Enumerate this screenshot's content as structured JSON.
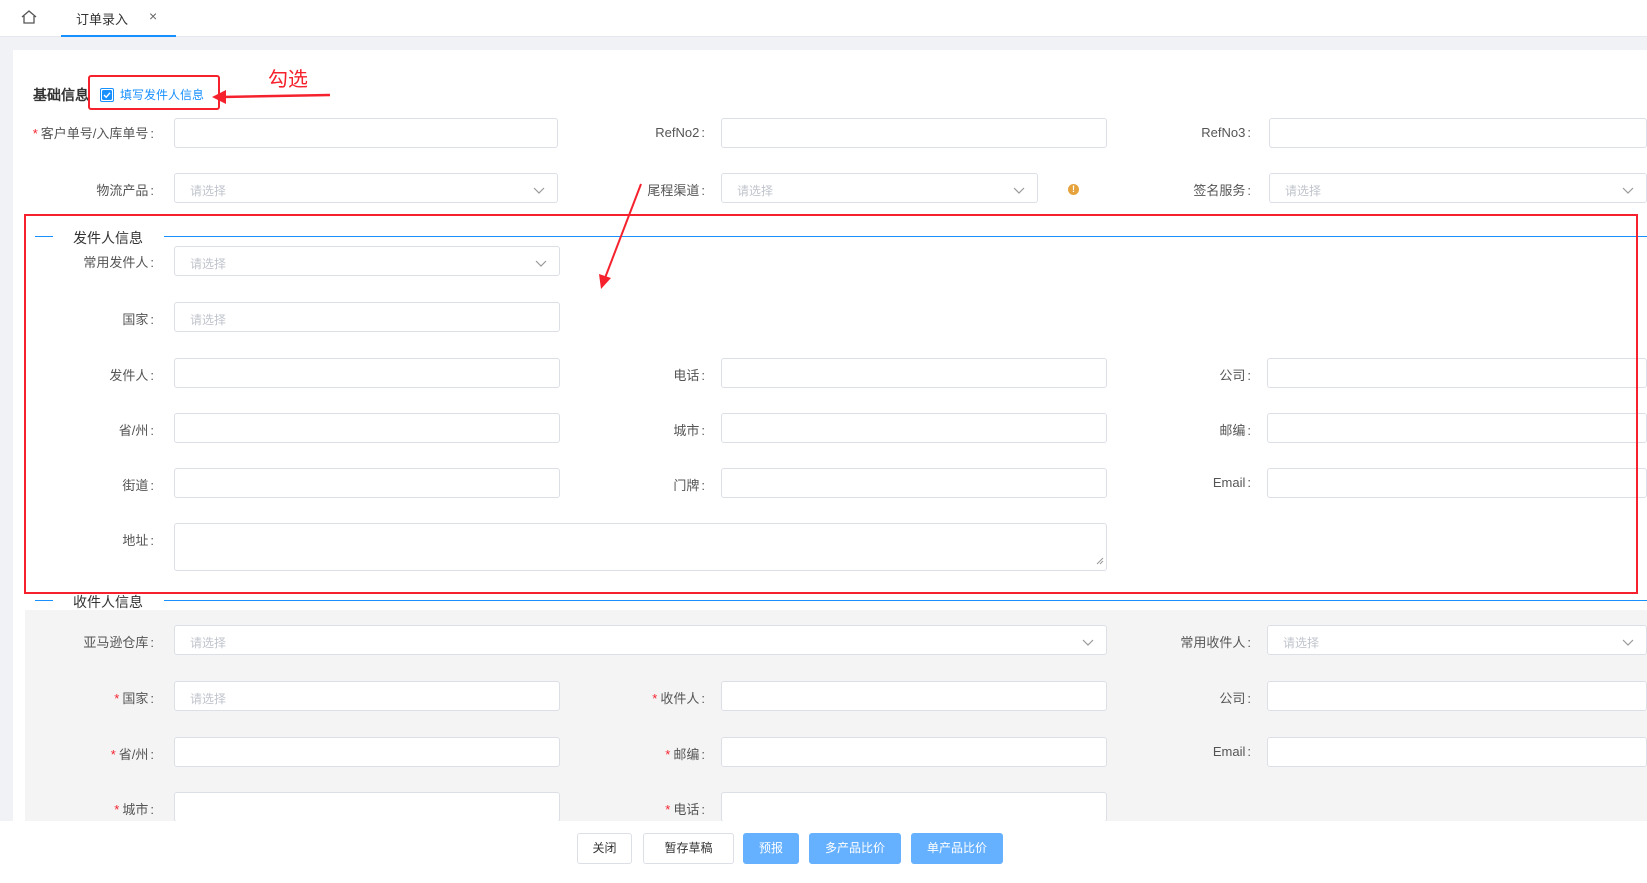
{
  "tabs": {
    "active_label": "订单录入",
    "close_glyph": "×"
  },
  "basic_info": {
    "title": "基础信息",
    "fill_sender_checkbox": {
      "label": "填写发件人信息",
      "checked": true
    },
    "fields": {
      "customer_no": {
        "label": "客户单号/入库单号",
        "required": true,
        "value": ""
      },
      "refno2": {
        "label": "RefNo2",
        "value": ""
      },
      "refno3": {
        "label": "RefNo3",
        "value": ""
      },
      "logistics_product": {
        "label": "物流产品",
        "placeholder": "请选择"
      },
      "last_mile_channel": {
        "label": "尾程渠道",
        "placeholder": "请选择"
      },
      "signature_service": {
        "label": "签名服务",
        "placeholder": "请选择"
      }
    }
  },
  "annotation": {
    "text": "勾选",
    "color": "#f5222d"
  },
  "sender": {
    "title": "发件人信息",
    "common_sender": {
      "label": "常用发件人",
      "placeholder": "请选择"
    },
    "country": {
      "label": "国家",
      "placeholder": "请选择"
    },
    "name": {
      "label": "发件人",
      "value": ""
    },
    "phone": {
      "label": "电话",
      "value": ""
    },
    "company": {
      "label": "公司",
      "value": ""
    },
    "province": {
      "label": "省/州",
      "value": ""
    },
    "city": {
      "label": "城市",
      "value": ""
    },
    "postcode": {
      "label": "邮编",
      "value": ""
    },
    "street": {
      "label": "街道",
      "value": ""
    },
    "house_no": {
      "label": "门牌",
      "value": ""
    },
    "email": {
      "label": "Email",
      "value": ""
    },
    "address": {
      "label": "地址",
      "value": ""
    }
  },
  "recipient": {
    "title": "收件人信息",
    "amazon_warehouse": {
      "label": "亚马逊仓库",
      "placeholder": "请选择"
    },
    "common_recipient": {
      "label": "常用收件人",
      "placeholder": "请选择"
    },
    "country": {
      "label": "国家",
      "required": true,
      "placeholder": "请选择"
    },
    "name": {
      "label": "收件人",
      "required": true,
      "value": ""
    },
    "company": {
      "label": "公司",
      "value": ""
    },
    "province": {
      "label": "省/州",
      "required": true,
      "value": ""
    },
    "postcode": {
      "label": "邮编",
      "required": true,
      "value": ""
    },
    "email": {
      "label": "Email",
      "value": ""
    },
    "city": {
      "label": "城市",
      "required": true,
      "value": ""
    },
    "phone": {
      "label": "电话",
      "required": true,
      "value": ""
    }
  },
  "footer": {
    "close": "关闭",
    "save_draft": "暂存草稿",
    "pre_report": "预报",
    "multi_compare": "多产品比价",
    "single_compare": "单产品比价"
  },
  "colors": {
    "primary": "#1890ff",
    "button_primary": "#66b1ff",
    "required": "#f5222d",
    "annotation": "#f5222d",
    "info": "#e6a23c"
  },
  "icons": [
    "home-icon",
    "close-icon",
    "checkbox-checked-icon",
    "chevron-down-icon",
    "info-icon",
    "resize-handle-icon",
    "annotation-arrow-icon"
  ]
}
